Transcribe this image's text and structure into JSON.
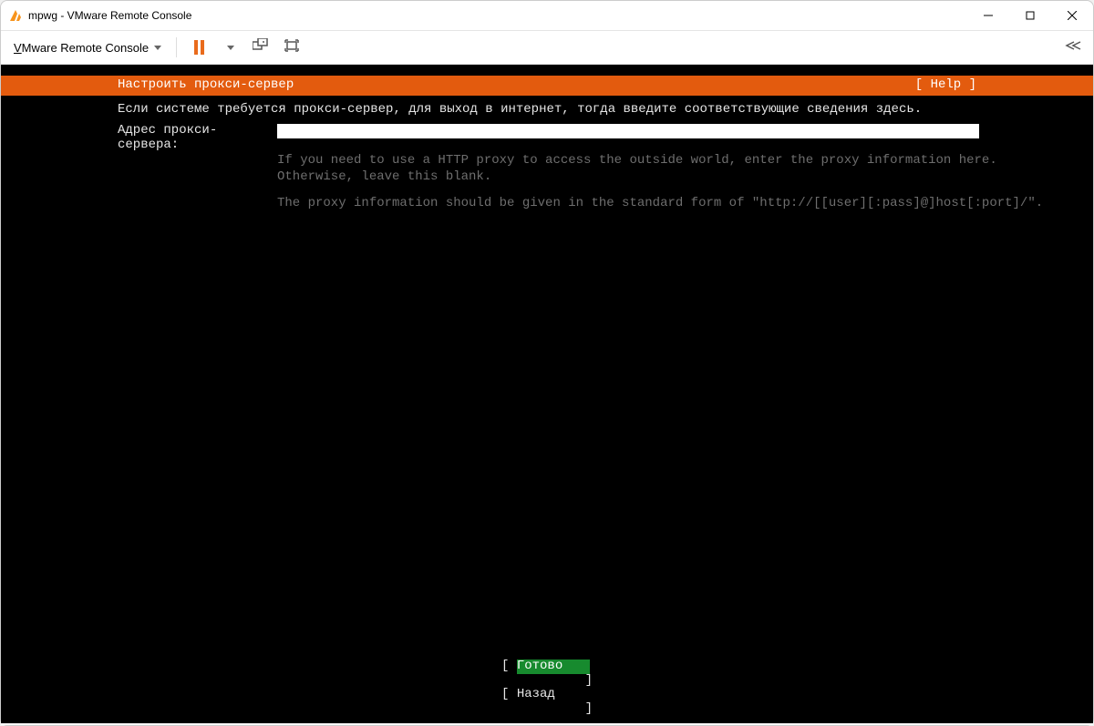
{
  "window": {
    "title": "mpwg - VMware Remote Console"
  },
  "toolbar": {
    "menu_label": "VMware Remote Console"
  },
  "installer": {
    "header_title": "Настроить прокси-сервер",
    "help_label": "[ Help ]",
    "instruction": "Если системе требуется прокси-сервер, для выход в интернет, тогда введите соответствующие сведения здесь.",
    "proxy_label": "Адрес прокси-сервера:",
    "proxy_value": "",
    "hint_line1": "If you need to use a HTTP proxy to access the outside world, enter the proxy information here.",
    "hint_line2": "Otherwise, leave this blank.",
    "hint_line3": "The proxy information should be given in the standard form of \"http://[[user][:pass]@]host[:port]/\".",
    "done_label": "Готово",
    "back_label": "Назад"
  }
}
